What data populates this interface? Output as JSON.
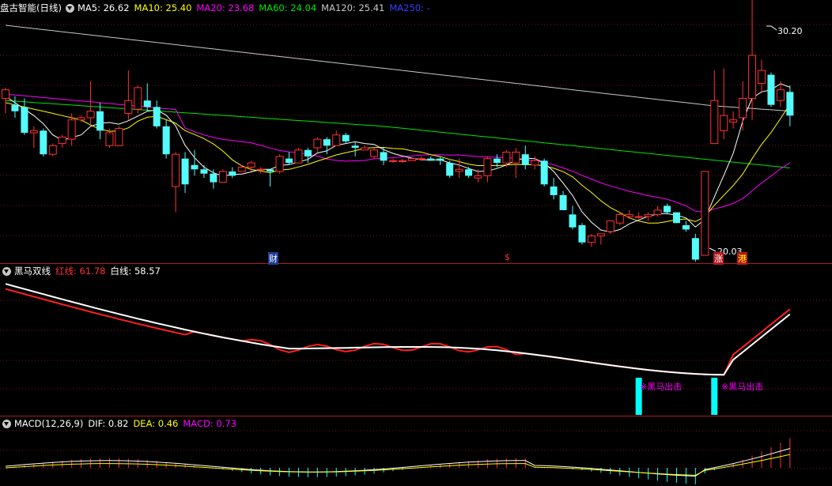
{
  "main_panel": {
    "title": "盘古智能(日线)",
    "ma5_label": "MA5: 26.62",
    "ma10_label": "MA10: 25.40",
    "ma20_label": "MA20: 23.68",
    "ma60_label": "MA60: 24.04",
    "ma120_label": "MA120: 25.41",
    "ma250_label": "MA250: -",
    "high_label": "30.20",
    "low_label": "20.03",
    "markers": [
      "财",
      "$",
      "涨",
      "港"
    ],
    "colors": {
      "up": "#ff3232",
      "down": "#54fcfc",
      "ma5": "#ffffff",
      "ma10": "#ffff00",
      "ma20": "#ff00ff",
      "ma60": "#00e600",
      "ma120": "#c8c8c8",
      "ma250": "#3c3cff"
    }
  },
  "heima_panel": {
    "title": "黑马双线",
    "red_label": "红线: 61.78",
    "white_label": "白线: 58.57",
    "signal_text": "※黑马出击",
    "signal_bars": [
      48.5,
      53.5
    ]
  },
  "macd_panel": {
    "title": "MACD(12,26,9)",
    "dif_label": "DIF: 0.82",
    "dea_label": "DEA: 0.46",
    "macd_label": "MACD: 0.73"
  },
  "chart_data": {
    "type": "candlestick",
    "candles": [
      {
        "o": 25.6,
        "h": 26.1,
        "l": 24.9,
        "c": 26.0
      },
      {
        "o": 25.3,
        "h": 25.7,
        "l": 24.7,
        "c": 25.0
      },
      {
        "o": 25.2,
        "h": 25.6,
        "l": 23.9,
        "c": 24.0
      },
      {
        "o": 24.0,
        "h": 24.3,
        "l": 23.3,
        "c": 24.1
      },
      {
        "o": 24.1,
        "h": 24.2,
        "l": 22.9,
        "c": 23.0
      },
      {
        "o": 23.0,
        "h": 23.5,
        "l": 22.9,
        "c": 23.4
      },
      {
        "o": 23.5,
        "h": 23.9,
        "l": 23.3,
        "c": 23.8
      },
      {
        "o": 23.7,
        "h": 24.9,
        "l": 23.4,
        "c": 24.6
      },
      {
        "o": 24.6,
        "h": 24.8,
        "l": 24.5,
        "c": 24.7
      },
      {
        "o": 24.7,
        "h": 26.4,
        "l": 24.4,
        "c": 25.0
      },
      {
        "o": 25.0,
        "h": 25.4,
        "l": 23.7,
        "c": 24.1
      },
      {
        "o": 23.4,
        "h": 24.2,
        "l": 23.3,
        "c": 24.0
      },
      {
        "o": 23.4,
        "h": 24.3,
        "l": 23.4,
        "c": 24.2
      },
      {
        "o": 24.9,
        "h": 26.9,
        "l": 24.6,
        "c": 25.5
      },
      {
        "o": 25.1,
        "h": 26.2,
        "l": 24.9,
        "c": 26.1
      },
      {
        "o": 25.5,
        "h": 26.3,
        "l": 25.0,
        "c": 25.2
      },
      {
        "o": 25.2,
        "h": 25.5,
        "l": 24.2,
        "c": 24.3
      },
      {
        "o": 24.3,
        "h": 24.6,
        "l": 22.8,
        "c": 23.0
      },
      {
        "o": 21.5,
        "h": 23.1,
        "l": 20.3,
        "c": 23.0
      },
      {
        "o": 22.8,
        "h": 23.1,
        "l": 21.2,
        "c": 21.6
      },
      {
        "o": 22.5,
        "h": 23.2,
        "l": 22.0,
        "c": 22.3
      },
      {
        "o": 22.3,
        "h": 22.5,
        "l": 21.9,
        "c": 22.1
      },
      {
        "o": 22.1,
        "h": 22.3,
        "l": 21.4,
        "c": 21.7
      },
      {
        "o": 21.7,
        "h": 22.3,
        "l": 21.7,
        "c": 22.2
      },
      {
        "o": 22.2,
        "h": 22.4,
        "l": 21.9,
        "c": 22.0
      },
      {
        "o": 22.2,
        "h": 22.5,
        "l": 22.2,
        "c": 22.4
      },
      {
        "o": 22.4,
        "h": 22.7,
        "l": 22.2,
        "c": 22.6
      },
      {
        "o": 22.3,
        "h": 22.4,
        "l": 22.1,
        "c": 22.3
      },
      {
        "o": 22.3,
        "h": 22.3,
        "l": 21.5,
        "c": 22.2
      },
      {
        "o": 22.2,
        "h": 23.0,
        "l": 22.1,
        "c": 22.9
      },
      {
        "o": 22.8,
        "h": 23.1,
        "l": 22.5,
        "c": 22.6
      },
      {
        "o": 22.6,
        "h": 23.3,
        "l": 22.6,
        "c": 23.2
      },
      {
        "o": 23.2,
        "h": 23.3,
        "l": 22.6,
        "c": 22.9
      },
      {
        "o": 23.3,
        "h": 23.8,
        "l": 23.1,
        "c": 23.7
      },
      {
        "o": 23.7,
        "h": 23.8,
        "l": 23.0,
        "c": 23.4
      },
      {
        "o": 23.4,
        "h": 24.1,
        "l": 23.4,
        "c": 23.9
      },
      {
        "o": 23.9,
        "h": 24.0,
        "l": 23.5,
        "c": 23.6
      },
      {
        "o": 23.4,
        "h": 23.6,
        "l": 22.9,
        "c": 23.3
      },
      {
        "o": 23.2,
        "h": 23.4,
        "l": 23.2,
        "c": 23.3
      },
      {
        "o": 22.9,
        "h": 23.3,
        "l": 22.8,
        "c": 23.2
      },
      {
        "o": 23.1,
        "h": 23.3,
        "l": 22.5,
        "c": 22.7
      },
      {
        "o": 22.7,
        "h": 22.8,
        "l": 22.6,
        "c": 22.7
      },
      {
        "o": 22.7,
        "h": 22.8,
        "l": 22.6,
        "c": 22.7
      },
      {
        "o": 22.7,
        "h": 22.8,
        "l": 22.7,
        "c": 22.8
      },
      {
        "o": 22.8,
        "h": 22.9,
        "l": 22.7,
        "c": 22.8
      },
      {
        "o": 22.8,
        "h": 22.9,
        "l": 22.7,
        "c": 22.7
      },
      {
        "o": 22.8,
        "h": 22.9,
        "l": 22.5,
        "c": 22.7
      },
      {
        "o": 22.6,
        "h": 22.7,
        "l": 21.9,
        "c": 22.0
      },
      {
        "o": 22.2,
        "h": 22.8,
        "l": 21.9,
        "c": 22.3
      },
      {
        "o": 22.3,
        "h": 22.4,
        "l": 21.9,
        "c": 22.0
      },
      {
        "o": 21.9,
        "h": 22.3,
        "l": 21.7,
        "c": 22.0
      },
      {
        "o": 22.0,
        "h": 22.9,
        "l": 21.7,
        "c": 22.8
      },
      {
        "o": 22.8,
        "h": 23.0,
        "l": 22.4,
        "c": 22.6
      },
      {
        "o": 22.6,
        "h": 23.2,
        "l": 22.4,
        "c": 23.1
      },
      {
        "o": 22.6,
        "h": 23.3,
        "l": 21.9,
        "c": 23.1
      },
      {
        "o": 23.0,
        "h": 23.4,
        "l": 22.3,
        "c": 22.5
      },
      {
        "o": 22.5,
        "h": 22.9,
        "l": 22.3,
        "c": 22.7
      },
      {
        "o": 22.7,
        "h": 22.8,
        "l": 21.5,
        "c": 21.6
      },
      {
        "o": 21.5,
        "h": 21.9,
        "l": 20.9,
        "c": 21.1
      },
      {
        "o": 21.1,
        "h": 21.3,
        "l": 20.4,
        "c": 20.4
      },
      {
        "o": 20.2,
        "h": 20.6,
        "l": 19.5,
        "c": 19.6
      },
      {
        "o": 19.7,
        "h": 19.8,
        "l": 18.8,
        "c": 18.9
      },
      {
        "o": 18.9,
        "h": 19.3,
        "l": 18.7,
        "c": 19.2
      },
      {
        "o": 19.2,
        "h": 19.3,
        "l": 18.8,
        "c": 19.3
      },
      {
        "o": 19.4,
        "h": 19.9,
        "l": 19.3,
        "c": 19.9
      },
      {
        "o": 19.8,
        "h": 20.3,
        "l": 19.7,
        "c": 20.2
      },
      {
        "o": 20.1,
        "h": 20.4,
        "l": 20.0,
        "c": 20.2
      },
      {
        "o": 20.1,
        "h": 20.3,
        "l": 20.0,
        "c": 20.1
      },
      {
        "o": 20.1,
        "h": 20.3,
        "l": 19.9,
        "c": 20.2
      },
      {
        "o": 20.2,
        "h": 20.6,
        "l": 20.1,
        "c": 20.4
      },
      {
        "o": 20.6,
        "h": 20.7,
        "l": 20.2,
        "c": 20.3
      },
      {
        "o": 20.3,
        "h": 20.3,
        "l": 19.8,
        "c": 19.8
      },
      {
        "o": 19.7,
        "h": 19.9,
        "l": 19.4,
        "c": 19.5
      },
      {
        "o": 19.1,
        "h": 19.3,
        "l": 18.0,
        "c": 18.1
      },
      {
        "o": 18.3,
        "h": 22.2,
        "l": 18.3,
        "c": 22.2
      },
      {
        "o": 23.5,
        "h": 26.9,
        "l": 23.5,
        "c": 25.5
      },
      {
        "o": 24.1,
        "h": 27.0,
        "l": 23.7,
        "c": 24.8
      },
      {
        "o": 24.5,
        "h": 25.0,
        "l": 24.2,
        "c": 24.6
      },
      {
        "o": 24.7,
        "h": 26.4,
        "l": 24.1,
        "c": 25.6
      },
      {
        "o": 25.6,
        "h": 30.2,
        "l": 24.6,
        "c": 27.6
      },
      {
        "o": 26.3,
        "h": 27.4,
        "l": 25.9,
        "c": 26.9
      },
      {
        "o": 26.7,
        "h": 26.8,
        "l": 25.2,
        "c": 25.3
      },
      {
        "o": 25.5,
        "h": 26.4,
        "l": 25.2,
        "c": 26.0
      },
      {
        "o": 25.9,
        "h": 26.2,
        "l": 24.3,
        "c": 24.8
      }
    ]
  }
}
